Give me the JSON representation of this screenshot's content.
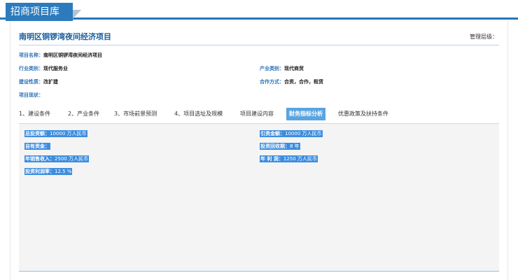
{
  "banner": {
    "title": "招商项目库"
  },
  "project": {
    "title": "南明区铜锣湾夜间经济项目",
    "management_level_label": "管理层级："
  },
  "info": {
    "name": {
      "label": "项目名称：",
      "value": "南明区铜锣湾夜间经济项目"
    },
    "industry": {
      "label": "行业类别：",
      "value": "现代服务业"
    },
    "sector": {
      "label": "产业类别：",
      "value": "现代商贸"
    },
    "construction": {
      "label": "建设性质：",
      "value": "改扩建"
    },
    "cooperation": {
      "label": "合作方式：",
      "value": "合资，合作，租赁"
    },
    "status": {
      "label": "项目现状：",
      "value": ""
    }
  },
  "tabs": [
    {
      "label": "1、建设条件"
    },
    {
      "label": "2、产业条件"
    },
    {
      "label": "3、市场前景预测"
    },
    {
      "label": "4、项目选址及规模"
    },
    {
      "label": "项目建设内容"
    },
    {
      "label": "财务指标分析"
    },
    {
      "label": "优惠政策及扶持条件"
    }
  ],
  "active_tab_index": 5,
  "metrics": {
    "total_investment": {
      "label": "总投资额：",
      "value": "10000 万人民币"
    },
    "attracted_investment": {
      "label": "引资金额：",
      "value": "10000 万人民币"
    },
    "own_funds": {
      "label": "自有资金：",
      "value": ""
    },
    "payback_period": {
      "label": "投资回收期：",
      "value": "8 年"
    },
    "annual_sales": {
      "label": "年销售收入：",
      "value": "2500 万人民币"
    },
    "annual_profit": {
      "label": "年 利 润：",
      "value": "1250 万人民币"
    },
    "profit_rate": {
      "label": "投资利润率：",
      "value": "12.5 %"
    }
  },
  "colors": {
    "accent": "#2c7bbd",
    "title_blue": "#1b5f9e",
    "label_blue": "#2b73b8",
    "active_tab": "#5aa4e0",
    "highlight": "#3c8ddf"
  }
}
